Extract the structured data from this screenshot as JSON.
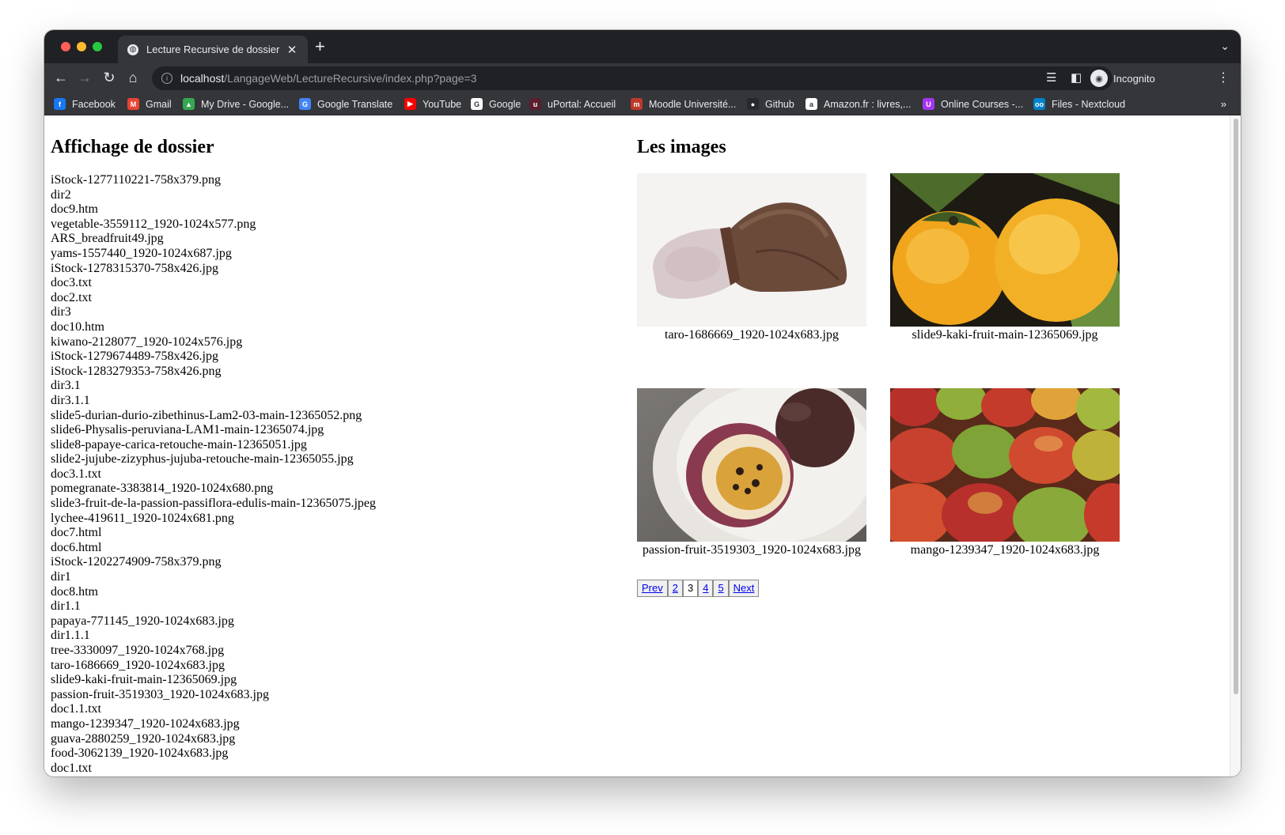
{
  "browser": {
    "tab_title": "Lecture Recursive de dossier",
    "url_host": "localhost",
    "url_path": "/LangageWeb/LectureRecursive/index.php?page=3",
    "profile_label": "Incognito",
    "bookmarks": [
      {
        "label": "Facebook",
        "icon": "facebook-icon",
        "color": "#1877f2",
        "glyph": "f"
      },
      {
        "label": "Gmail",
        "icon": "gmail-icon",
        "color": "#ea4335",
        "glyph": "M"
      },
      {
        "label": "My Drive - Google...",
        "icon": "google-drive-icon",
        "color": "#34a853",
        "glyph": "▲"
      },
      {
        "label": "Google Translate",
        "icon": "google-translate-icon",
        "color": "#4285f4",
        "glyph": "G"
      },
      {
        "label": "YouTube",
        "icon": "youtube-icon",
        "color": "#ff0000",
        "glyph": "▶"
      },
      {
        "label": "Google",
        "icon": "google-icon",
        "color": "#ffffff",
        "glyph": "G"
      },
      {
        "label": "uPortal: Accueil",
        "icon": "uportal-icon",
        "color": "#5a1f2e",
        "glyph": "u"
      },
      {
        "label": "Moodle Université...",
        "icon": "moodle-icon",
        "color": "#c0392b",
        "glyph": "m"
      },
      {
        "label": "Github",
        "icon": "github-icon",
        "color": "#24292f",
        "glyph": "●"
      },
      {
        "label": "Amazon.fr : livres,...",
        "icon": "amazon-icon",
        "color": "#ffffff",
        "glyph": "a"
      },
      {
        "label": "Online Courses -...",
        "icon": "udemy-icon",
        "color": "#a435f0",
        "glyph": "U"
      },
      {
        "label": "Files - Nextcloud",
        "icon": "nextcloud-icon",
        "color": "#0082c9",
        "glyph": "oo"
      }
    ]
  },
  "left": {
    "heading": "Affichage de dossier",
    "files": [
      "iStock-1277110221-758x379.png",
      "dir2",
      "doc9.htm",
      "vegetable-3559112_1920-1024x577.png",
      "ARS_breadfruit49.jpg",
      "yams-1557440_1920-1024x687.jpg",
      "iStock-1278315370-758x426.jpg",
      "doc3.txt",
      "doc2.txt",
      "dir3",
      "doc10.htm",
      "kiwano-2128077_1920-1024x576.jpg",
      "iStock-1279674489-758x426.jpg",
      "iStock-1283279353-758x426.png",
      "dir3.1",
      "dir3.1.1",
      "slide5-durian-durio-zibethinus-Lam2-03-main-12365052.png",
      "slide6-Physalis-peruviana-LAM1-main-12365074.jpg",
      "slide8-papaye-carica-retouche-main-12365051.jpg",
      "slide2-jujube-zizyphus-jujuba-retouche-main-12365055.jpg",
      "doc3.1.txt",
      "pomegranate-3383814_1920-1024x680.png",
      "slide3-fruit-de-la-passion-passiflora-edulis-main-12365075.jpeg",
      "lychee-419611_1920-1024x681.png",
      "doc7.html",
      "doc6.html",
      "iStock-1202274909-758x379.png",
      "dir1",
      "doc8.htm",
      "dir1.1",
      "papaya-771145_1920-1024x683.jpg",
      "dir1.1.1",
      "tree-3330097_1920-1024x768.jpg",
      "taro-1686669_1920-1024x683.jpg",
      "slide9-kaki-fruit-main-12365069.jpg",
      "passion-fruit-3519303_1920-1024x683.jpg",
      "doc1.1.txt",
      "mango-1239347_1920-1024x683.jpg",
      "guava-2880259_1920-1024x683.jpg",
      "food-3062139_1920-1024x683.jpg",
      "doc1.txt"
    ]
  },
  "right": {
    "heading": "Les images",
    "images": [
      {
        "caption": "taro-1686669_1920-1024x683.jpg"
      },
      {
        "caption": "slide9-kaki-fruit-main-12365069.jpg"
      },
      {
        "caption": "passion-fruit-3519303_1920-1024x683.jpg"
      },
      {
        "caption": "mango-1239347_1920-1024x683.jpg"
      }
    ],
    "pagination": {
      "prev": "Prev",
      "pages": [
        "2",
        "3",
        "4",
        "5"
      ],
      "current": "3",
      "next": "Next"
    }
  }
}
